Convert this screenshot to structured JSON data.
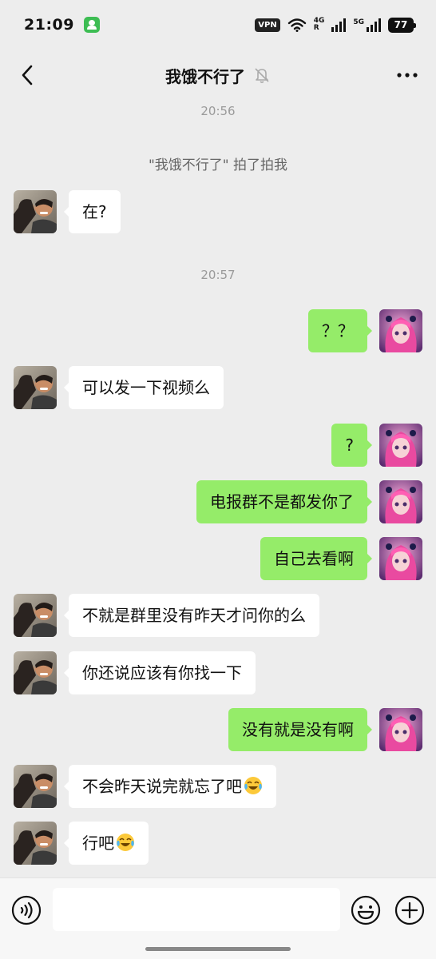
{
  "status_bar": {
    "time": "21:09",
    "vpn": "VPN",
    "net1": "4G",
    "net1_sub": "R",
    "net2": "5G",
    "battery": "77"
  },
  "header": {
    "title": "我饿不行了",
    "muted": true
  },
  "chat": {
    "timestamps": [
      "20:56",
      "20:57"
    ],
    "system_message": "\"我饿不行了\" 拍了拍我",
    "messages": [
      {
        "side": "left",
        "text": "在?"
      },
      {
        "side": "right",
        "text": "？？"
      },
      {
        "side": "left",
        "text": "可以发一下视频么"
      },
      {
        "side": "right",
        "text": "?"
      },
      {
        "side": "right",
        "text": "电报群不是都发你了"
      },
      {
        "side": "right",
        "text": "自己去看啊"
      },
      {
        "side": "left",
        "text": "不就是群里没有昨天才问你的么"
      },
      {
        "side": "left",
        "text": "你还说应该有你找一下"
      },
      {
        "side": "right",
        "text": "没有就是没有啊"
      },
      {
        "side": "left",
        "text": "不会昨天说完就忘了吧",
        "emoji": "crying-laughing-emoji"
      },
      {
        "side": "left",
        "text": "行吧",
        "emoji": "crying-laughing-emoji"
      }
    ]
  },
  "input_bar": {
    "input_value": "",
    "icons": [
      "voice-icon",
      "emoji-icon",
      "plus-icon"
    ]
  },
  "colors": {
    "background": "#ededed",
    "bubble_sent": "#95ec69",
    "bubble_received": "#ffffff"
  }
}
